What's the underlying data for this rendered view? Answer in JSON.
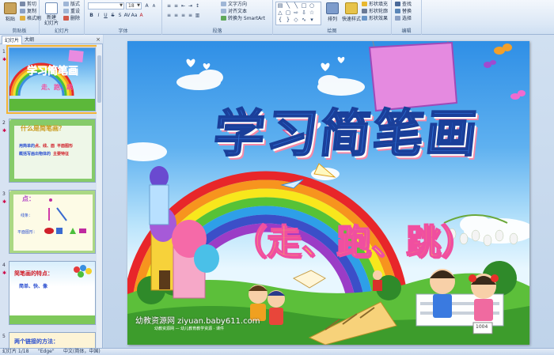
{
  "ribbon": {
    "groups": {
      "clipboard": "剪贴板",
      "slides": "幻灯片",
      "font": "字体",
      "paragraph": "段落",
      "drawing": "绘图",
      "editing": "编辑"
    },
    "clipboard": {
      "paste": "粘贴",
      "cut": "剪切",
      "copy": "复制",
      "format_painter": "格式刷"
    },
    "slides": {
      "new_slide": "新建\n幻灯片",
      "layout": "版式",
      "reset": "重设",
      "delete": "删除"
    },
    "font": {
      "size": "18"
    },
    "paragraph": {
      "text_direction": "文字方向",
      "align_text": "对齐文本",
      "smartart": "转换为 SmartArt"
    },
    "drawing": {
      "arrange": "排列",
      "quick_styles": "快速样式",
      "shape_fill": "形状填充",
      "shape_outline": "形状轮廓",
      "shape_effects": "形状效果"
    },
    "editing": {
      "find": "查找",
      "replace": "替换",
      "select": "选择"
    }
  },
  "panel": {
    "tab_slides": "幻灯片",
    "tab_outline": "大纲",
    "close": "×",
    "star": "✱"
  },
  "thumbnails": [
    {
      "number": "1",
      "title": "学习简笔画",
      "subtitle": "走、跑、跳"
    },
    {
      "number": "2",
      "title": "什么是简笔画？",
      "line1_a": "用简单的",
      "line1_b": "点、线、面",
      "line1_c": "平面图形",
      "line2_a": "概括写画出物体的",
      "line2_b": "主要特征"
    },
    {
      "number": "3",
      "title": "点：",
      "row2": "线条：",
      "row3": "平面图形："
    },
    {
      "number": "4",
      "title": "简笔画的特点：",
      "line1": "简单、快、像"
    },
    {
      "number": "5",
      "title": "两个链接的方法："
    }
  ],
  "slide": {
    "title": "学习简笔画",
    "subtitle": "（走、跑、跳）",
    "watermark": "幼教资源网 ziyuan.baby611.com",
    "watermark_small": "幼教资源网 — 幼儿教育教学资源 · 课件",
    "bench_number": "1004"
  },
  "status": {
    "slide_info": "幻灯片 1/18",
    "theme": "\"Edge\"",
    "language": "中文(简体，中国)"
  },
  "colors": {
    "ribbon_bg": "#dce8f6",
    "title_blue": "#2f6fd6",
    "subtitle_pink": "#f04fa0",
    "selected_outline": "#f2b335"
  }
}
